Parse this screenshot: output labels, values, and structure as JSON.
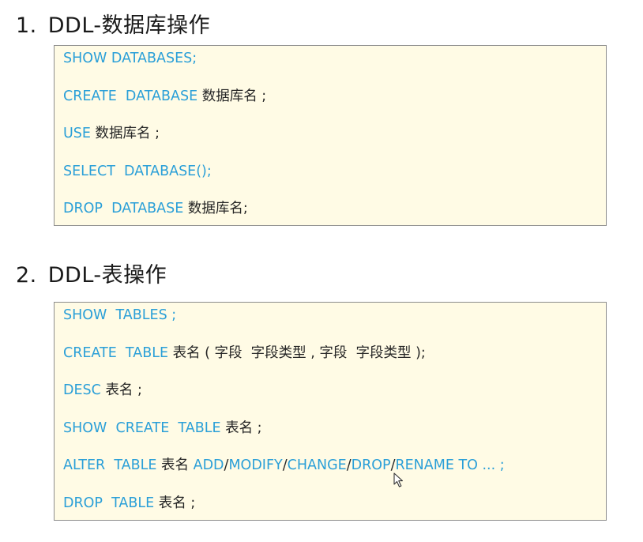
{
  "section1": {
    "number": "1.",
    "title": "DDL-数据库操作",
    "lines": [
      [
        {
          "t": "kw",
          "v": "SHOW DATABASES;"
        }
      ],
      [
        {
          "t": "kw",
          "v": "CREATE  DATABASE "
        },
        {
          "t": "tx",
          "v": "数据库名 ;"
        }
      ],
      [
        {
          "t": "kw",
          "v": "USE "
        },
        {
          "t": "tx",
          "v": "数据库名 ;"
        }
      ],
      [
        {
          "t": "kw",
          "v": "SELECT  DATABASE();"
        }
      ],
      [
        {
          "t": "kw",
          "v": "DROP  DATABASE "
        },
        {
          "t": "tx",
          "v": "数据库名;"
        }
      ]
    ]
  },
  "section2": {
    "number": "2.",
    "title": "DDL-表操作",
    "lines": [
      [
        {
          "t": "kw",
          "v": "SHOW  TABLES ;"
        }
      ],
      [
        {
          "t": "kw",
          "v": "CREATE  TABLE "
        },
        {
          "t": "tx",
          "v": "表名 ( 字段  字段类型 , 字段  字段类型 );"
        }
      ],
      [
        {
          "t": "kw",
          "v": "DESC "
        },
        {
          "t": "tx",
          "v": "表名 ;"
        }
      ],
      [
        {
          "t": "kw",
          "v": "SHOW  CREATE  TABLE "
        },
        {
          "t": "tx",
          "v": "表名 ;"
        }
      ],
      [
        {
          "t": "kw",
          "v": "ALTER  TABLE "
        },
        {
          "t": "tx",
          "v": "表名 "
        },
        {
          "t": "kw",
          "v": "ADD"
        },
        {
          "t": "tx",
          "v": "/"
        },
        {
          "t": "kw",
          "v": "MODIFY"
        },
        {
          "t": "tx",
          "v": "/"
        },
        {
          "t": "kw",
          "v": "CHANGE"
        },
        {
          "t": "tx",
          "v": "/"
        },
        {
          "t": "kw",
          "v": "DROP"
        },
        {
          "t": "tx",
          "v": "/"
        },
        {
          "t": "kw",
          "v": "RENAME TO ... ;"
        }
      ],
      [
        {
          "t": "kw",
          "v": "DROP  TABLE "
        },
        {
          "t": "tx",
          "v": "表名 ;"
        }
      ]
    ]
  },
  "colors": {
    "keyword": "#2a9fd8",
    "text": "#262626",
    "box_background": "#fffbe5",
    "box_border": "#8c8c8c"
  },
  "icons": {
    "cursor": "mouse-pointer-icon"
  }
}
